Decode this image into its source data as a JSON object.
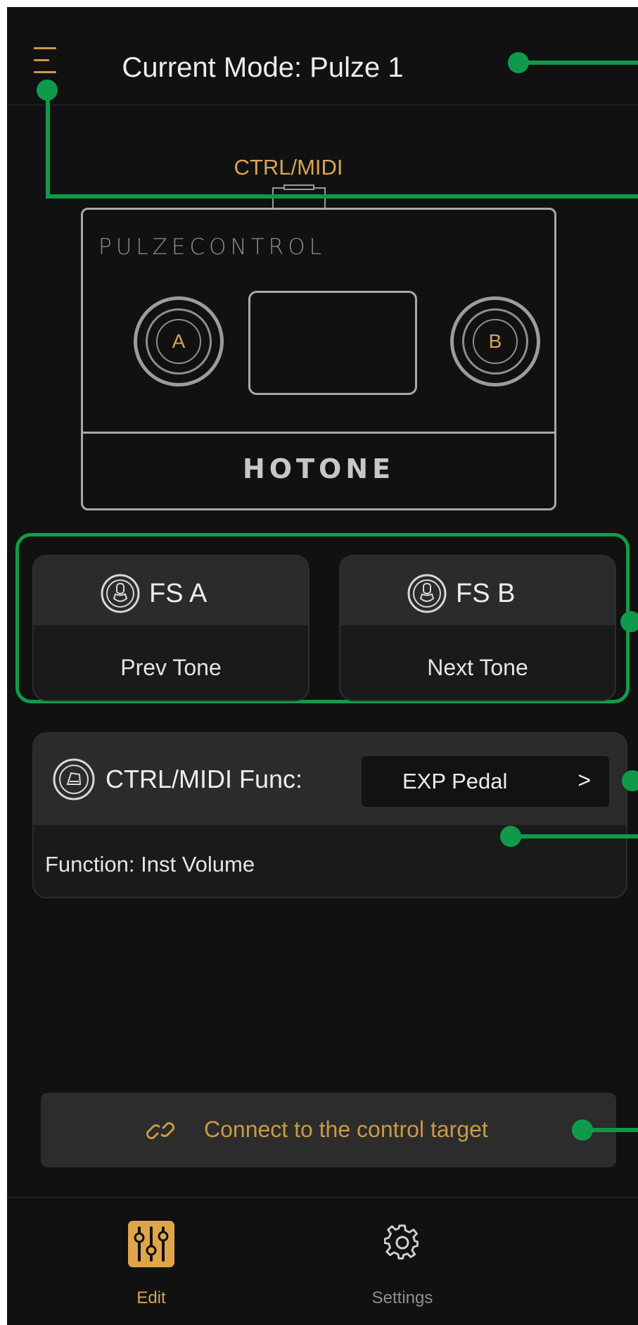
{
  "header": {
    "title": "Current Mode: Pulze 1"
  },
  "device": {
    "port_label": "CTRL/MIDI",
    "brand_top": "PULZECONTROL",
    "brand_bottom": "HOTONE",
    "footswitch_a": "A",
    "footswitch_b": "B"
  },
  "footswitches": [
    {
      "name": "FS A",
      "function": "Prev Tone",
      "icon": "footswitch-icon"
    },
    {
      "name": "FS B",
      "function": "Next Tone",
      "icon": "footswitch-icon"
    }
  ],
  "ctrl_midi": {
    "label": "CTRL/MIDI Func:",
    "selected": "EXP Pedal",
    "chevron": ">",
    "function_text": "Function: Inst Volume",
    "icon": "expression-pedal-icon"
  },
  "connect_button": {
    "label": "Connect to the control target",
    "icon": "link-icon"
  },
  "bottom_nav": [
    {
      "label": "Edit",
      "icon": "mixer-sliders-icon",
      "active": true
    },
    {
      "label": "Settings",
      "icon": "gear-icon",
      "active": false
    }
  ],
  "colors": {
    "background": "#111111",
    "accent": "#d7a455",
    "annotation": "#0f9a4b",
    "card": "#2b2b2b"
  }
}
